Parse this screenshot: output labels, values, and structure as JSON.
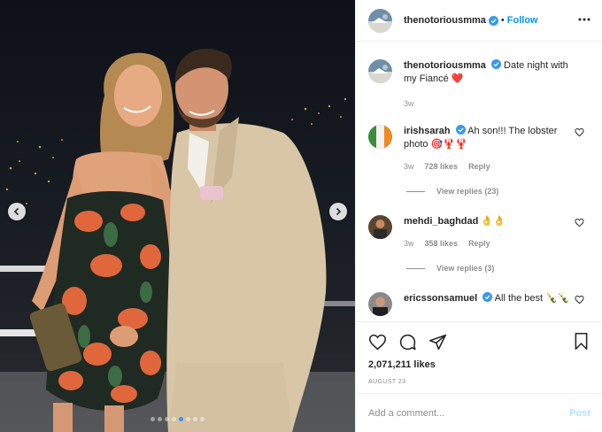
{
  "post": {
    "image_alt": "Couple posing on a balcony at night"
  },
  "carousel": {
    "total": 8,
    "active_index": 4
  },
  "header": {
    "username": "thenotoriousmma",
    "separator": "•",
    "follow_label": "Follow"
  },
  "caption": {
    "username": "thenotoriousmma",
    "text": "Date night with my Fiancé ❤️",
    "time": "3w"
  },
  "comments": [
    {
      "username": "irishsarah",
      "text": "Ah son!!! The lobster photo 🎯🦞🦞",
      "time": "3w",
      "likes": "728 likes",
      "reply_label": "Reply",
      "view_replies": "View replies (23)"
    },
    {
      "username": "mehdi_baghdad",
      "text": "👌👌",
      "time": "3w",
      "likes": "358 likes",
      "reply_label": "Reply",
      "view_replies": "View replies (3)"
    },
    {
      "username": "ericssonsamuel",
      "text": "All the best 🍾🍾"
    }
  ],
  "likes_count": "2,071,211 likes",
  "date": "AUGUST 23",
  "add_comment": {
    "placeholder": "Add a comment...",
    "post_label": "Post"
  },
  "colors": {
    "accent": "#0095f6",
    "verified": "#3897f0",
    "muted": "#8e8e8e",
    "post_disabled": "#b2dffc"
  }
}
